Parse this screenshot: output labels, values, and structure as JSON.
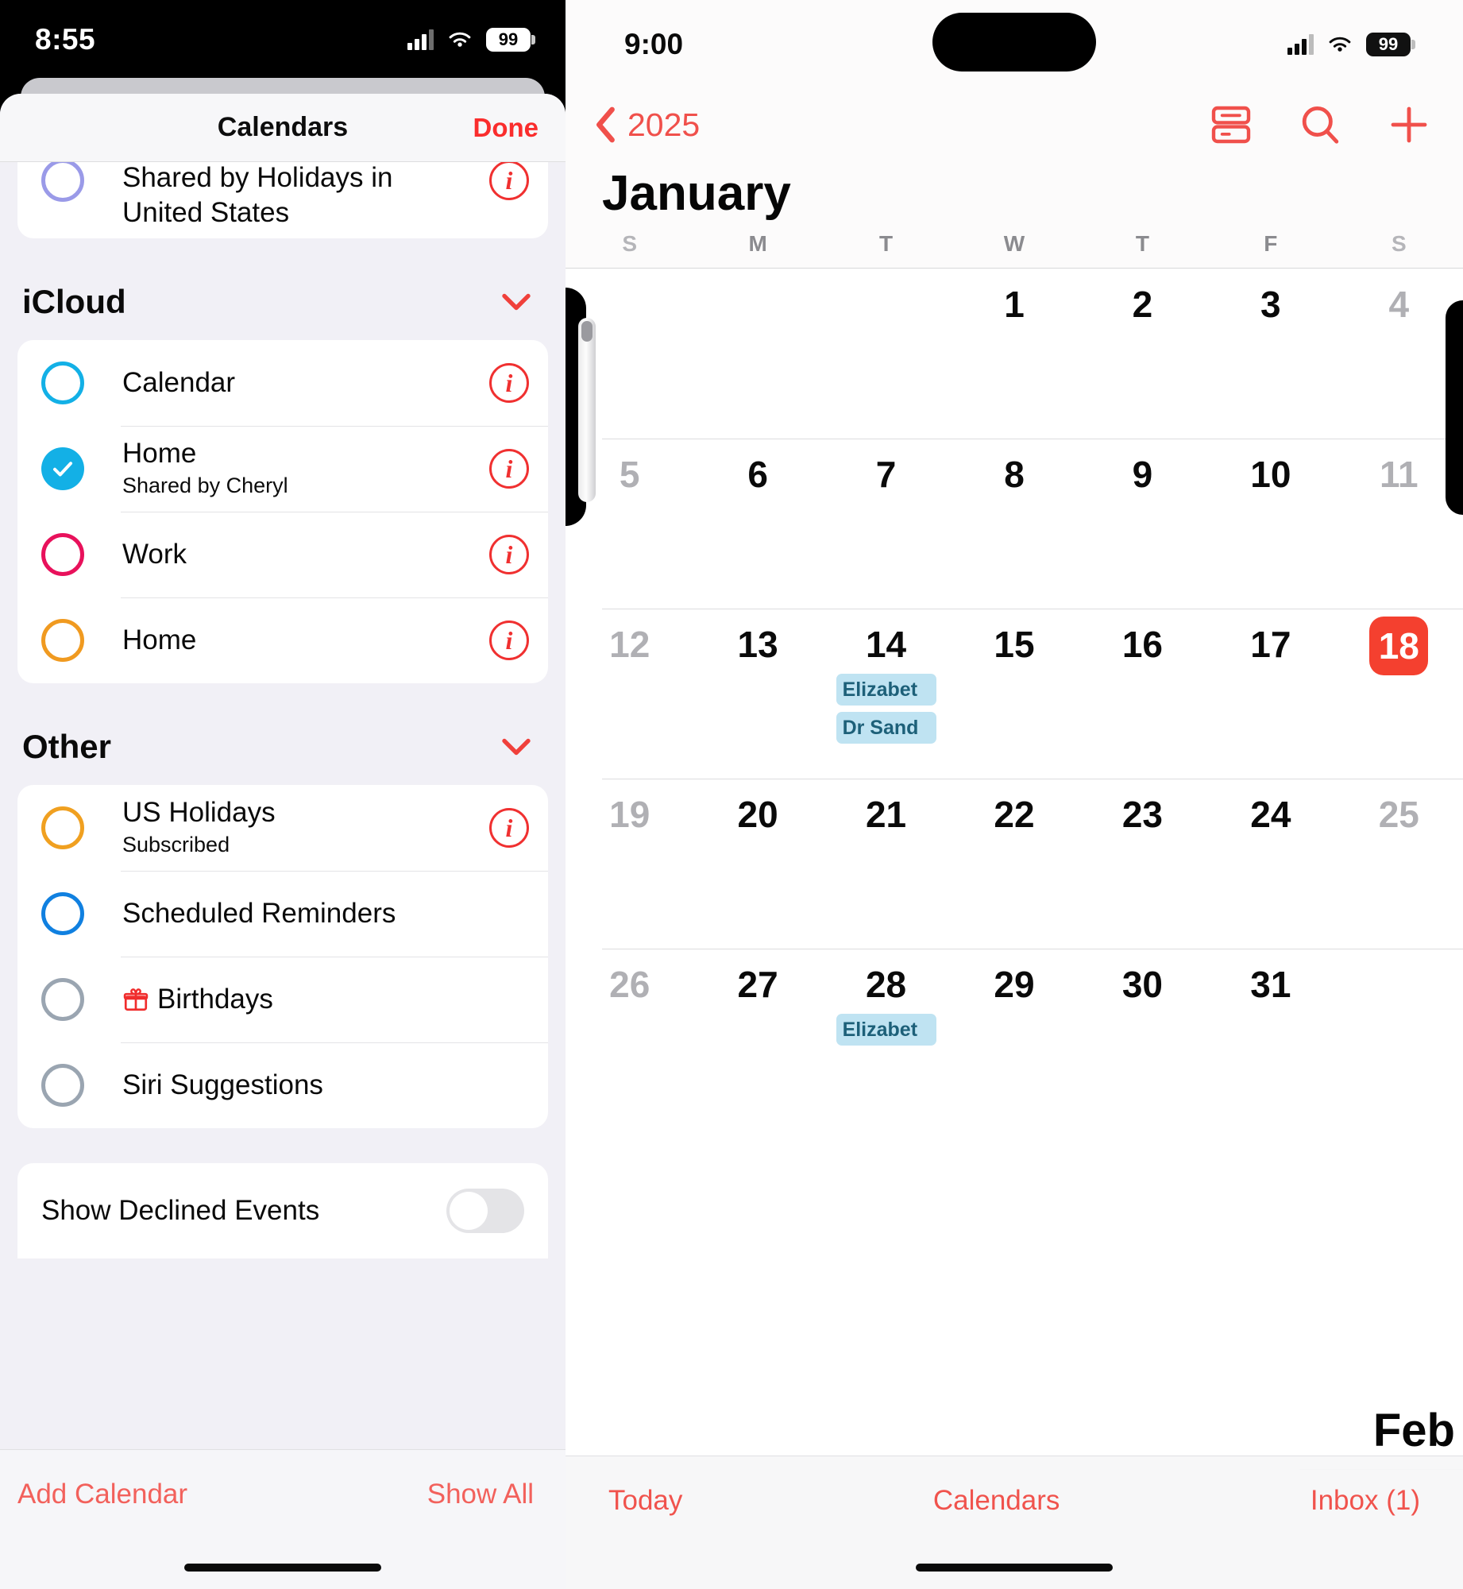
{
  "left": {
    "status": {
      "time": "8:55",
      "battery": "99"
    },
    "sheet": {
      "title": "Calendars",
      "done_label": "Done"
    },
    "top_partial_row": {
      "title_line1": "Shared by Holidays in",
      "title_line2": "United States",
      "color": "#9a9ae8",
      "checked": false,
      "info": "i"
    },
    "groups": [
      {
        "name": "iCloud",
        "chevron": "chevron-down",
        "items": [
          {
            "label": "Calendar",
            "sub": "",
            "color": "#13b0e6",
            "checked": false,
            "has_info": true
          },
          {
            "label": "Home",
            "sub": "Shared by Cheryl",
            "color": "#13b0e6",
            "checked": true,
            "has_info": true
          },
          {
            "label": "Work",
            "sub": "",
            "color": "#e8115b",
            "checked": false,
            "has_info": true
          },
          {
            "label": "Home",
            "sub": "",
            "color": "#f09a20",
            "checked": false,
            "has_info": true
          }
        ]
      },
      {
        "name": "Other",
        "chevron": "chevron-down",
        "items": [
          {
            "label": "US Holidays",
            "sub": "Subscribed",
            "color": "#f0a020",
            "checked": false,
            "has_info": true
          },
          {
            "label": "Scheduled Reminders",
            "sub": "",
            "color": "#1080e0",
            "checked": false,
            "has_info": false
          },
          {
            "label": "Birthdays",
            "sub": "",
            "color": "#9aa5b1",
            "checked": false,
            "has_info": false,
            "icon": "gift-icon",
            "icon_glyph": "🎁"
          },
          {
            "label": "Siri Suggestions",
            "sub": "",
            "color": "#9aa5b1",
            "checked": false,
            "has_info": false
          }
        ]
      }
    ],
    "declined": {
      "label": "Show Declined Events",
      "toggle_on": false
    },
    "toolbar": {
      "add_calendar": "Add Calendar",
      "show_all": "Show All"
    }
  },
  "right": {
    "status": {
      "time": "9:00",
      "battery": "99"
    },
    "nav": {
      "back_label": "2025",
      "icons": [
        "list-view-icon",
        "search-icon",
        "add-event-icon"
      ]
    },
    "month_title": "January",
    "weekdays": [
      "S",
      "M",
      "T",
      "W",
      "T",
      "F",
      "S"
    ],
    "today": 18,
    "next_month_label": "Feb",
    "weeks": [
      [
        {
          "num": "",
          "muted": false,
          "events": []
        },
        {
          "num": "",
          "muted": false,
          "events": []
        },
        {
          "num": "",
          "muted": false,
          "events": []
        },
        {
          "num": "1",
          "muted": false,
          "events": []
        },
        {
          "num": "2",
          "muted": false,
          "events": []
        },
        {
          "num": "3",
          "muted": false,
          "events": []
        },
        {
          "num": "4",
          "muted": true,
          "events": []
        }
      ],
      [
        {
          "num": "5",
          "muted": true,
          "events": []
        },
        {
          "num": "6",
          "muted": false,
          "events": []
        },
        {
          "num": "7",
          "muted": false,
          "events": []
        },
        {
          "num": "8",
          "muted": false,
          "events": []
        },
        {
          "num": "9",
          "muted": false,
          "events": []
        },
        {
          "num": "10",
          "muted": false,
          "events": []
        },
        {
          "num": "11",
          "muted": true,
          "events": []
        }
      ],
      [
        {
          "num": "12",
          "muted": true,
          "events": []
        },
        {
          "num": "13",
          "muted": false,
          "events": []
        },
        {
          "num": "14",
          "muted": false,
          "events": [
            "Elizabet",
            "Dr Sand"
          ]
        },
        {
          "num": "15",
          "muted": false,
          "events": []
        },
        {
          "num": "16",
          "muted": false,
          "events": []
        },
        {
          "num": "17",
          "muted": false,
          "events": []
        },
        {
          "num": "18",
          "muted": false,
          "events": [],
          "today": true
        }
      ],
      [
        {
          "num": "19",
          "muted": true,
          "events": []
        },
        {
          "num": "20",
          "muted": false,
          "events": []
        },
        {
          "num": "21",
          "muted": false,
          "events": []
        },
        {
          "num": "22",
          "muted": false,
          "events": []
        },
        {
          "num": "23",
          "muted": false,
          "events": []
        },
        {
          "num": "24",
          "muted": false,
          "events": []
        },
        {
          "num": "25",
          "muted": true,
          "events": []
        }
      ],
      [
        {
          "num": "26",
          "muted": true,
          "events": []
        },
        {
          "num": "27",
          "muted": false,
          "events": []
        },
        {
          "num": "28",
          "muted": false,
          "events": [
            "Elizabet"
          ]
        },
        {
          "num": "29",
          "muted": false,
          "events": []
        },
        {
          "num": "30",
          "muted": false,
          "events": []
        },
        {
          "num": "31",
          "muted": false,
          "events": []
        },
        {
          "num": "",
          "muted": false,
          "events": []
        }
      ]
    ],
    "toolbar": {
      "today": "Today",
      "calendars": "Calendars",
      "inbox": "Inbox (1)"
    }
  },
  "colors": {
    "accent_red": "#f0504b",
    "today_red": "#f4402f",
    "chip_bg": "#bfe3f2",
    "chip_text": "#1d6079"
  }
}
